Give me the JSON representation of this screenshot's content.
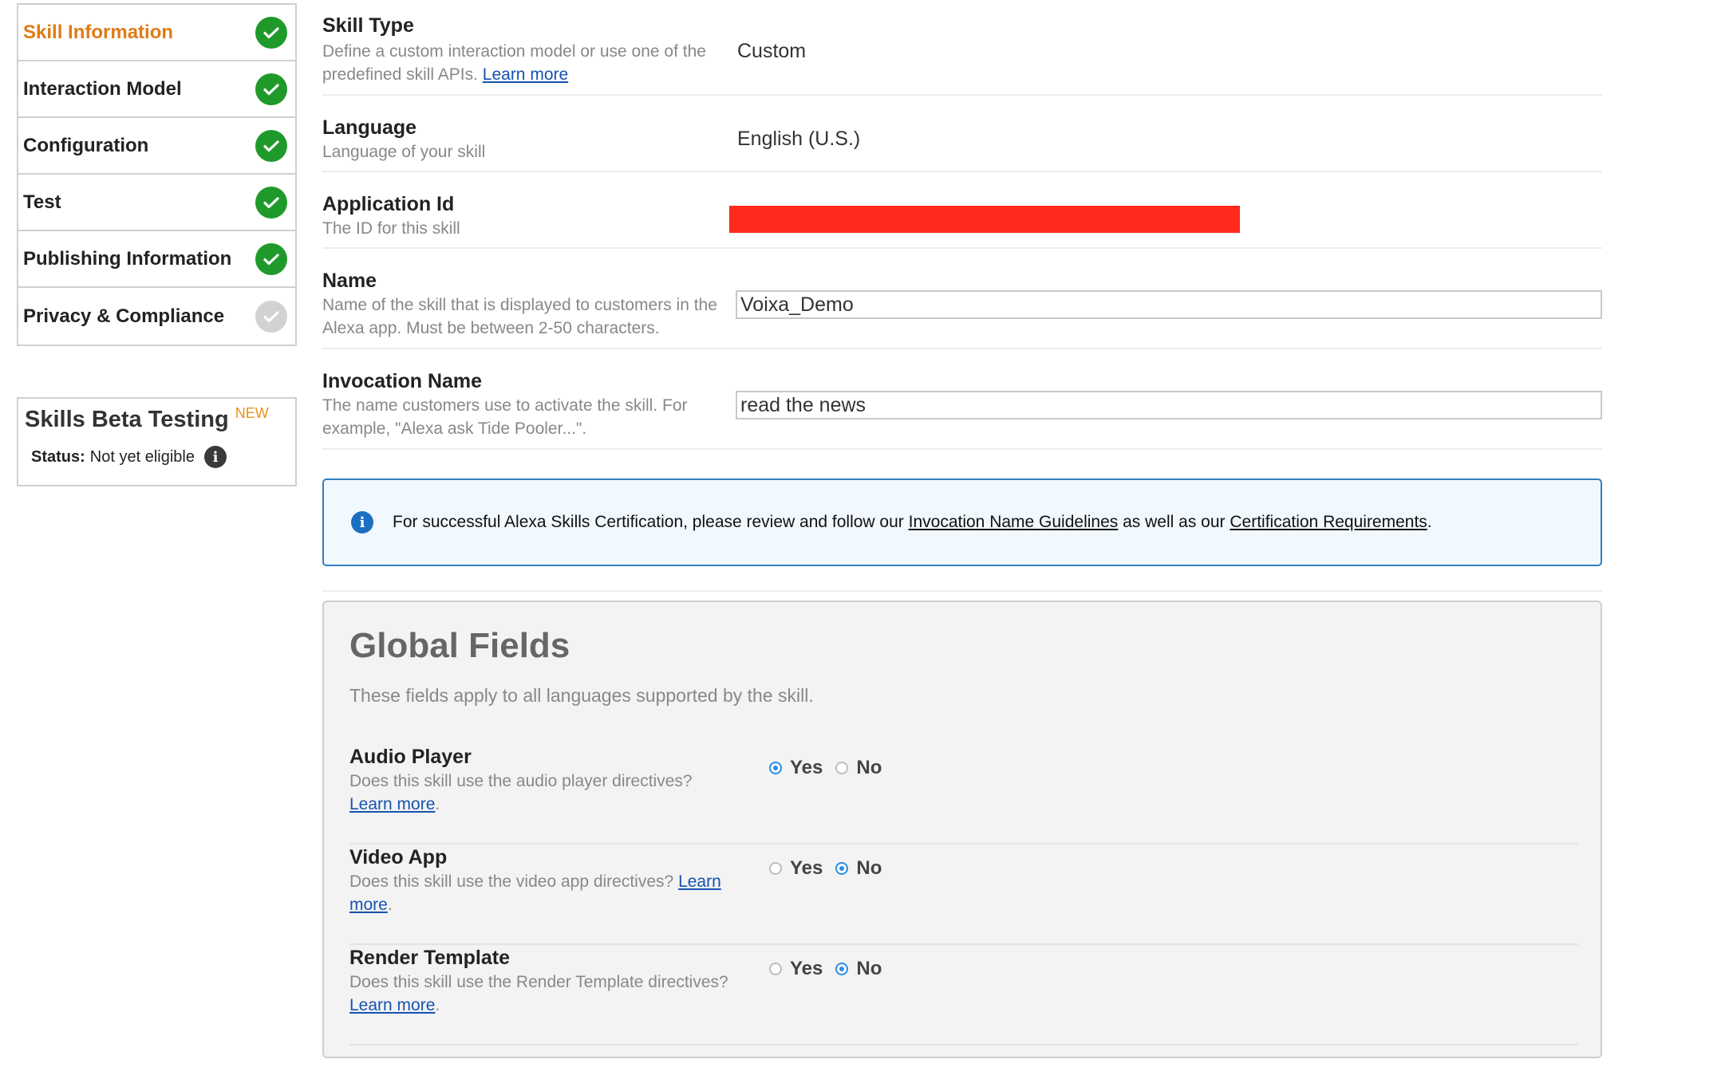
{
  "nav": {
    "items": [
      {
        "label": "Skill Information",
        "status": "done",
        "active": true
      },
      {
        "label": "Interaction Model",
        "status": "done",
        "active": false
      },
      {
        "label": "Configuration",
        "status": "done",
        "active": false
      },
      {
        "label": "Test",
        "status": "done",
        "active": false
      },
      {
        "label": "Publishing Information",
        "status": "done",
        "active": false
      },
      {
        "label": "Privacy & Compliance",
        "status": "pending",
        "active": false
      }
    ]
  },
  "beta": {
    "title": "Skills Beta Testing",
    "badge": "NEW",
    "status_label": "Status:",
    "status_value": "Not yet eligible",
    "info_icon": "info-circle-icon"
  },
  "fields": {
    "skill_type": {
      "label": "Skill Type",
      "desc_text": "Define a custom interaction model or use one of the predefined skill APIs.",
      "link": "Learn more",
      "value": "Custom"
    },
    "language": {
      "label": "Language",
      "desc": "Language of your skill",
      "value": "English (U.S.)"
    },
    "application_id": {
      "label": "Application Id",
      "desc": "The ID for this skill"
    },
    "name": {
      "label": "Name",
      "desc": "Name of the skill that is displayed to customers in the Alexa app. Must be between 2-50 characters.",
      "value": "Voixa_Demo"
    },
    "invocation_name": {
      "label": "Invocation Name",
      "desc": "The name customers use to activate the skill. For example, \"Alexa ask Tide Pooler...\".",
      "value": "read the news"
    }
  },
  "callout": {
    "text_before": "For successful Alexa Skills Certification, please review and follow our",
    "link1": "Invocation Name Guidelines",
    "text_middle": "as well as our",
    "link2": "Certification Requirements",
    "text_after": "."
  },
  "global": {
    "title": "Global Fields",
    "subtitle": "These fields apply to all languages supported by the skill.",
    "yes_label": "Yes",
    "no_label": "No",
    "rows": [
      {
        "label": "Audio Player",
        "desc": "Does this skill use the audio player directives?",
        "link": "Learn more",
        "selected": "Yes"
      },
      {
        "label": "Video App",
        "desc": "Does this skill use the video app directives?",
        "link": "Learn more",
        "selected": "No"
      },
      {
        "label": "Render Template",
        "desc": "Does this skill use the Render Template directives?",
        "link": "Learn more",
        "selected": "No"
      }
    ]
  },
  "colors": {
    "active_nav": "#e07b16",
    "check_done": "#1f9a2a",
    "check_pending": "#d2d2d2",
    "link": "#1652b0",
    "callout_border": "#2f7fc1",
    "redaction": "#ff2a1b",
    "radio_selected": "#2b8de6"
  }
}
